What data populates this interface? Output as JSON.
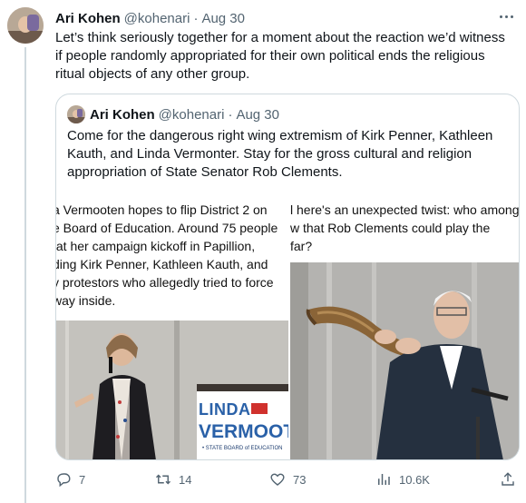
{
  "tweet": {
    "author_name": "Ari Kohen",
    "author_handle": "@kohenari",
    "separator": "·",
    "date": "Aug 30",
    "text": "Let’s think seriously together for a moment about the reaction we’d witness if people randomly appropriated for their own political ends the religious ritual objects of any other group."
  },
  "quote": {
    "author_name": "Ari Kohen",
    "author_handle": "@kohenari",
    "separator": "·",
    "date": "Aug 30",
    "text": "Come for the dangerous right wing extremism of Kirk Penner, Kathleen Kauth, and Linda Vermonter. Stay for the gross cultural and religion appropriation of State Senator Rob Clements."
  },
  "media": {
    "left_article_text": "a Vermooten hopes to flip District 2 on\ne Board of Education. Around 75 people\n at her campaign kickoff in Papillion,\nding Kirk Penner, Kathleen Kauth, and \ny protestors who allegedly tried to force\nway inside.",
    "right_article_text": "l here's an unexpected twist: who among\nw that Rob Clements could play the\nfar?",
    "sign_line1": "LINDA",
    "sign_line2": "VERMOOTEN",
    "sign_line3": "• STATE BOARD of EDUCATION"
  },
  "actions": {
    "reply_count": "7",
    "retweet_count": "14",
    "like_count": "73",
    "views_count": "10.6K"
  },
  "colors": {
    "text_primary": "#0f1419",
    "text_secondary": "#536471",
    "border": "#cfd9de",
    "sign_blue": "#2a61a8"
  },
  "icons": {
    "reply": "reply-icon",
    "retweet": "retweet-icon",
    "like": "heart-icon",
    "views": "views-chart-icon",
    "share": "share-icon",
    "more": "more-dots-icon"
  }
}
